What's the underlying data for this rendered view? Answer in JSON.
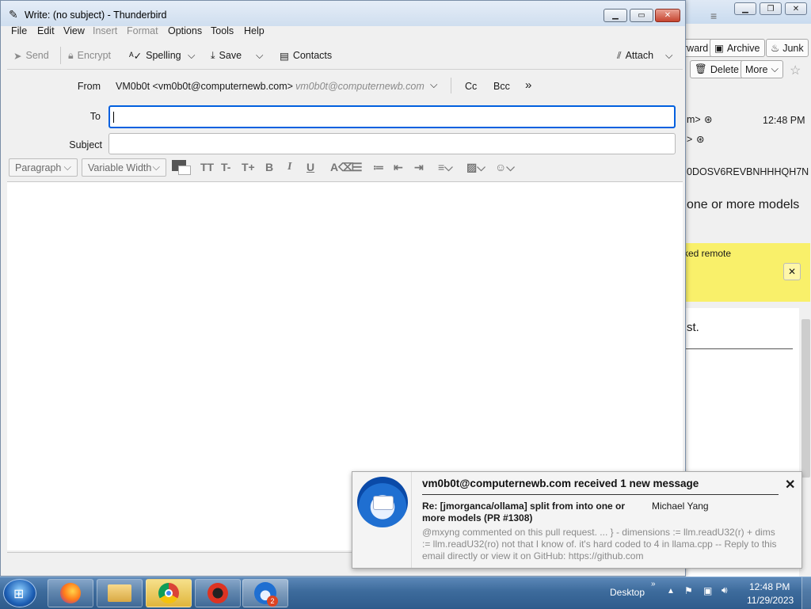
{
  "compose": {
    "title": "Write: (no subject) - Thunderbird",
    "menu": [
      "File",
      "Edit",
      "View",
      "Insert",
      "Format",
      "Options",
      "Tools",
      "Help"
    ],
    "toolbar": {
      "send": "Send",
      "encrypt": "Encrypt",
      "spelling": "Spelling",
      "save": "Save",
      "contacts": "Contacts",
      "attach": "Attach"
    },
    "headers": {
      "from_label": "From",
      "from_value": "VM0b0t <vm0b0t@computernewb.com>",
      "from_identity": "vm0b0t@computernewb.com",
      "cc": "Cc",
      "bcc": "Bcc",
      "to_label": "To",
      "to_value": "",
      "subject_label": "Subject",
      "subject_value": ""
    },
    "format": {
      "paragraph": "Paragraph",
      "font": "Variable Width"
    }
  },
  "background": {
    "toolbar": {
      "forward": "rward",
      "archive": "Archive",
      "junk": "Junk",
      "delete": "Delete",
      "more": "More"
    },
    "sender1": "m>",
    "sender2": ">",
    "time": "12:48 PM",
    "msgid": "0DOSV6REVBNHHHQH7N",
    "subject_frag": "one or more models",
    "remote_frag": "ked remote",
    "body_frag": "st."
  },
  "notification": {
    "header": "vm0b0t@computernewb.com received 1 new message",
    "subject": "Re: [jmorganca/ollama] split from into one or more models (PR #1308)",
    "sender": "Michael Yang",
    "preview": "@mxyng commented on this pull request. ... } - dimensions := llm.readU32(r) + dims := llm.readU32(ro) not that I know of. it's hard coded to 4 in llama.cpp -- Reply to this email directly or view it on GitHub: https://github.com"
  },
  "taskbar": {
    "desktop": "Desktop",
    "time": "12:48 PM",
    "date": "11/29/2023",
    "badge": "2"
  },
  "colors": {
    "accent": "#0060df",
    "notif_yellow": "#f9f06a",
    "taskbar": "#3d6b9c"
  }
}
